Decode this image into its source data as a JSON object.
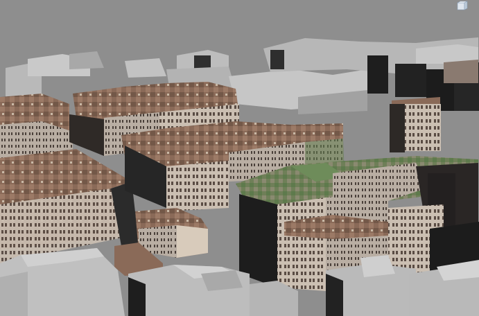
{
  "viewport": {
    "background": "#8e8e8e",
    "colors": {
      "ground": "#8b8b8b",
      "untextured_roof": "#b9b9b9",
      "untextured_wall": "#d8d8d8",
      "untextured_shadow": "#3a3a3a",
      "textured_roof": "#8a6a58",
      "textured_wall": "#cbbfb2",
      "textured_dark": "#3c3632",
      "vegetation": "#5e7a4c"
    }
  },
  "icons": [
    "nav-cube-icon"
  ]
}
